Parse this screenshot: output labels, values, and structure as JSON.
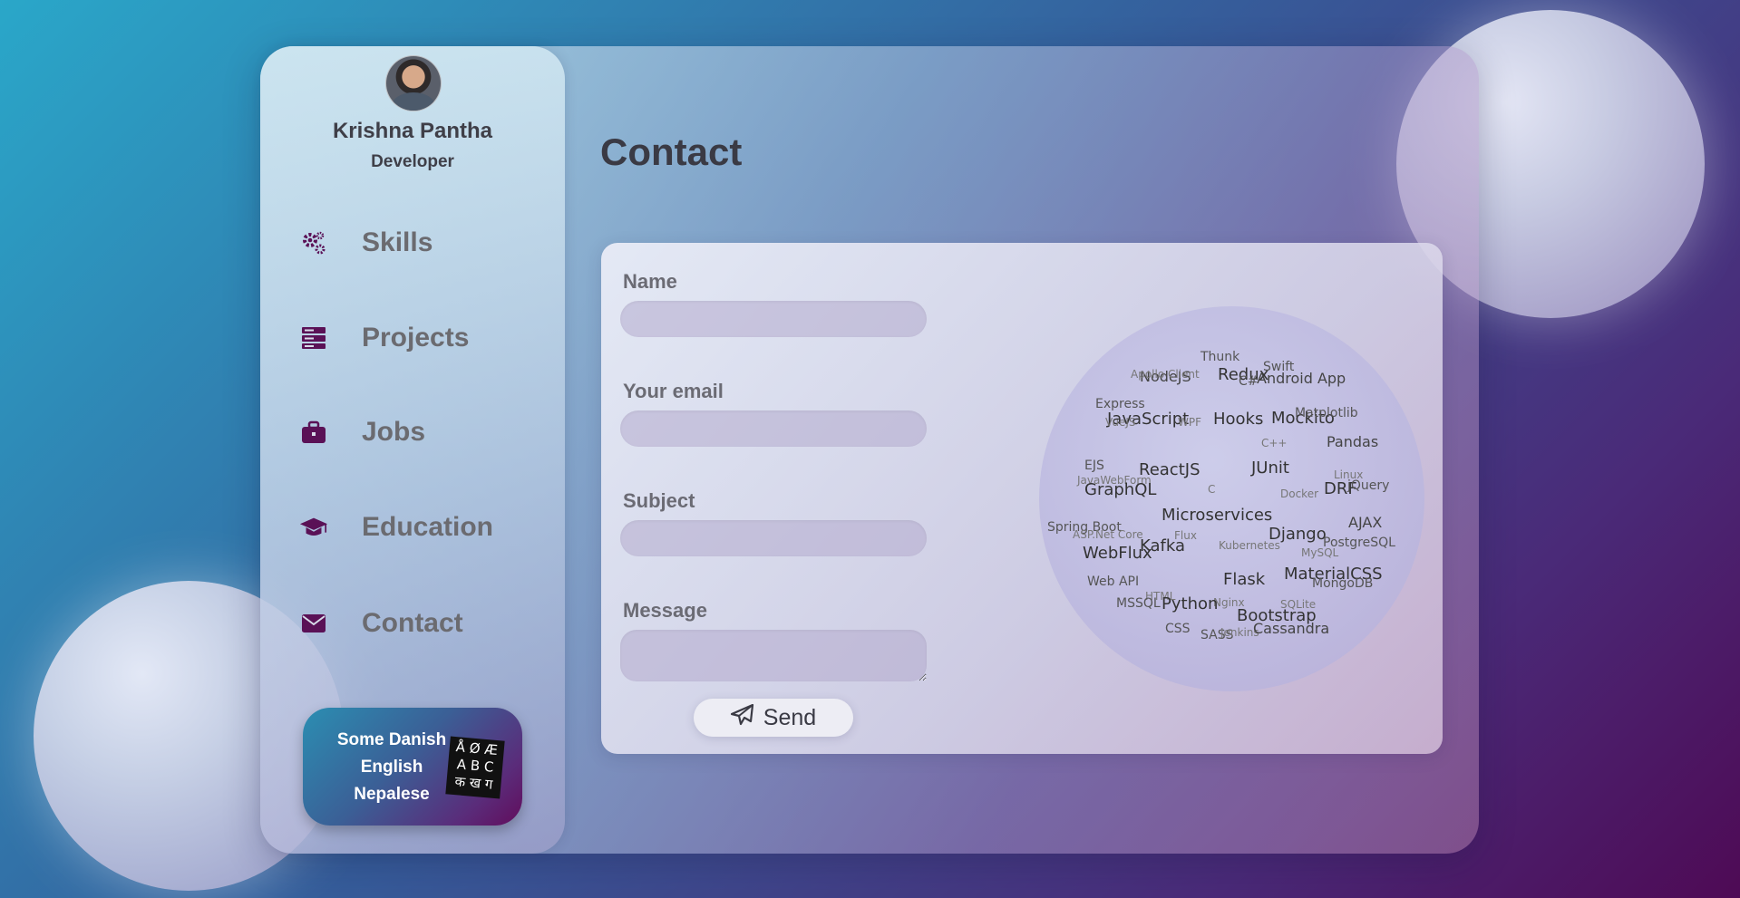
{
  "profile": {
    "name": "Krishna Pantha",
    "role": "Developer"
  },
  "nav": [
    {
      "label": "Skills",
      "icon": "gears-icon"
    },
    {
      "label": "Projects",
      "icon": "server-icon"
    },
    {
      "label": "Jobs",
      "icon": "briefcase-icon"
    },
    {
      "label": "Education",
      "icon": "graduation-cap-icon"
    },
    {
      "label": "Contact",
      "icon": "envelope-icon"
    }
  ],
  "languages": {
    "lines": [
      "Some Danish",
      "English",
      "Nepalese"
    ],
    "logo_glyphs": [
      "Å Ø Æ",
      "A B C",
      "क ख ग"
    ]
  },
  "page": {
    "title": "Contact"
  },
  "form": {
    "name_label": "Name",
    "email_label": "Your email",
    "subject_label": "Subject",
    "message_label": "Message",
    "name_value": "",
    "email_value": "",
    "subject_value": "",
    "message_value": "",
    "send_label": "Send"
  },
  "skills_cloud": [
    {
      "text": "Thunk",
      "tier": 3
    },
    {
      "text": "Swift",
      "tier": 3
    },
    {
      "text": "Redux",
      "tier": 1
    },
    {
      "text": "NodeJS",
      "tier": 2
    },
    {
      "text": "Apollo Client",
      "tier": 4
    },
    {
      "text": "C#",
      "tier": 3
    },
    {
      "text": "Android App",
      "tier": 2
    },
    {
      "text": "Express",
      "tier": 3
    },
    {
      "text": "JavaScript",
      "tier": 1
    },
    {
      "text": "Hooks",
      "tier": 1
    },
    {
      "text": "VueJS",
      "tier": 4
    },
    {
      "text": "WPF",
      "tier": 4
    },
    {
      "text": "Mockito",
      "tier": 1
    },
    {
      "text": "Matplotlib",
      "tier": 3
    },
    {
      "text": "Pandas",
      "tier": 2
    },
    {
      "text": "C++",
      "tier": 4
    },
    {
      "text": "EJS",
      "tier": 3
    },
    {
      "text": "ReactJS",
      "tier": 1
    },
    {
      "text": "JUnit",
      "tier": 1
    },
    {
      "text": "Linux",
      "tier": 4
    },
    {
      "text": "JavaWebForm",
      "tier": 4
    },
    {
      "text": "GraphQL",
      "tier": 1
    },
    {
      "text": "C",
      "tier": 4
    },
    {
      "text": "DRF",
      "tier": 1
    },
    {
      "text": "jQuery",
      "tier": 3
    },
    {
      "text": "Docker",
      "tier": 4
    },
    {
      "text": "Microservices",
      "tier": 1
    },
    {
      "text": "AJAX",
      "tier": 2
    },
    {
      "text": "Spring Boot",
      "tier": 3
    },
    {
      "text": "ASP.Net Core",
      "tier": 4
    },
    {
      "text": "Flux",
      "tier": 4
    },
    {
      "text": "Django",
      "tier": 1
    },
    {
      "text": "Kafka",
      "tier": 1
    },
    {
      "text": "Kubernetes",
      "tier": 4
    },
    {
      "text": "PostgreSQL",
      "tier": 3
    },
    {
      "text": "WebFlux",
      "tier": 1
    },
    {
      "text": "MySQL",
      "tier": 4
    },
    {
      "text": "MaterialCSS",
      "tier": 1
    },
    {
      "text": "Web API",
      "tier": 3
    },
    {
      "text": "Flask",
      "tier": 1
    },
    {
      "text": "MongoDB",
      "tier": 3
    },
    {
      "text": "HTML",
      "tier": 4
    },
    {
      "text": "Nginx",
      "tier": 4
    },
    {
      "text": "MSSQL",
      "tier": 3
    },
    {
      "text": "Python",
      "tier": 1
    },
    {
      "text": "SQLite",
      "tier": 4
    },
    {
      "text": "Bootstrap",
      "tier": 1
    },
    {
      "text": "CSS",
      "tier": 3
    },
    {
      "text": "SASS",
      "tier": 3
    },
    {
      "text": "Jenkins",
      "tier": 4
    },
    {
      "text": "Cassandra",
      "tier": 2
    }
  ],
  "colors": {
    "accent": "#5a1156",
    "text_dark": "#3a3a44",
    "nav_text": "#6b6b70"
  }
}
